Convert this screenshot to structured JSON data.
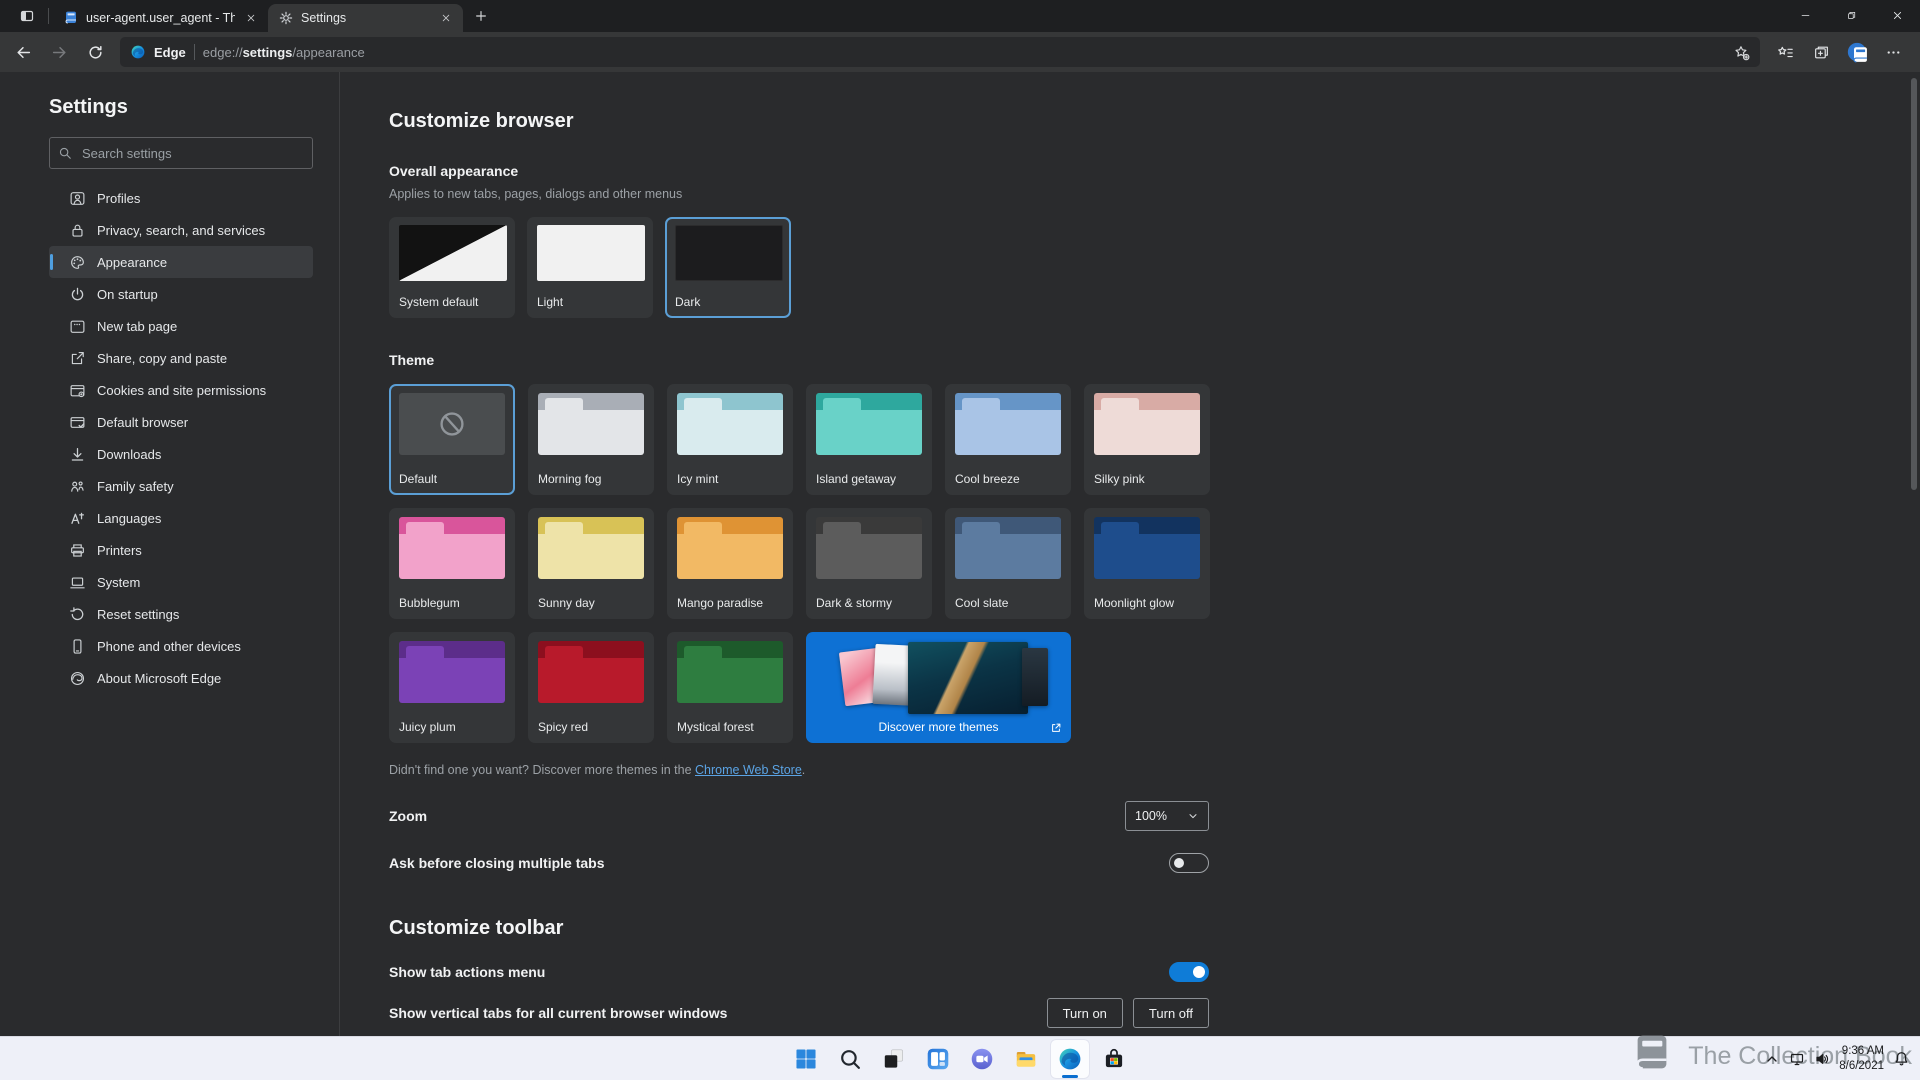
{
  "window": {
    "tabs": [
      {
        "title": "user-agent.user_agent - The Coll",
        "icon": "book-icon",
        "active": false
      },
      {
        "title": "Settings",
        "icon": "gear-icon",
        "active": true
      }
    ]
  },
  "toolbar": {
    "site_label": "Edge",
    "url_scheme": "edge://",
    "url_host": "settings",
    "url_path": "/appearance"
  },
  "sidebar": {
    "title": "Settings",
    "search_placeholder": "Search settings",
    "items": [
      {
        "label": "Profiles",
        "icon": "profiles-icon",
        "selected": false
      },
      {
        "label": "Privacy, search, and services",
        "icon": "privacy-lock-icon",
        "selected": false
      },
      {
        "label": "Appearance",
        "icon": "appearance-palette-icon",
        "selected": true
      },
      {
        "label": "On startup",
        "icon": "power-icon",
        "selected": false
      },
      {
        "label": "New tab page",
        "icon": "new-tab-page-icon",
        "selected": false
      },
      {
        "label": "Share, copy and paste",
        "icon": "share-icon",
        "selected": false
      },
      {
        "label": "Cookies and site permissions",
        "icon": "cookies-icon",
        "selected": false
      },
      {
        "label": "Default browser",
        "icon": "default-browser-icon",
        "selected": false
      },
      {
        "label": "Downloads",
        "icon": "download-icon",
        "selected": false
      },
      {
        "label": "Family safety",
        "icon": "family-icon",
        "selected": false
      },
      {
        "label": "Languages",
        "icon": "languages-icon",
        "selected": false
      },
      {
        "label": "Printers",
        "icon": "printer-icon",
        "selected": false
      },
      {
        "label": "System",
        "icon": "laptop-icon",
        "selected": false
      },
      {
        "label": "Reset settings",
        "icon": "reset-icon",
        "selected": false
      },
      {
        "label": "Phone and other devices",
        "icon": "phone-icon",
        "selected": false
      },
      {
        "label": "About Microsoft Edge",
        "icon": "edge-logo-icon",
        "selected": false
      }
    ]
  },
  "main": {
    "title": "Customize browser",
    "overall": {
      "heading": "Overall appearance",
      "subheading": "Applies to new tabs, pages, dialogs and other menus",
      "options": [
        {
          "label": "System default",
          "thumb": "system",
          "selected": false
        },
        {
          "label": "Light",
          "thumb": "light",
          "selected": false
        },
        {
          "label": "Dark",
          "thumb": "dark",
          "selected": true
        }
      ]
    },
    "theme": {
      "heading": "Theme",
      "items": [
        {
          "label": "Default",
          "empty": true,
          "selected": true
        },
        {
          "label": "Morning fog",
          "body": "#e3e5e8",
          "header": "#a9aeb6"
        },
        {
          "label": "Icy mint",
          "body": "#d9ebee",
          "header": "#8ec5cf"
        },
        {
          "label": "Island getaway",
          "body": "#69d2c8",
          "header": "#2ea89e"
        },
        {
          "label": "Cool breeze",
          "body": "#a9c4e6",
          "header": "#6695c7"
        },
        {
          "label": "Silky pink",
          "body": "#eedbd7",
          "header": "#d8aba5"
        },
        {
          "label": "Bubblegum",
          "body": "#f2a2ca",
          "header": "#d9559b"
        },
        {
          "label": "Sunny day",
          "body": "#eee3a8",
          "header": "#d8c256"
        },
        {
          "label": "Mango paradise",
          "body": "#f2b964",
          "header": "#df9334"
        },
        {
          "label": "Dark & stormy",
          "body": "#5c5c5c",
          "header": "#3a3a3a"
        },
        {
          "label": "Cool slate",
          "body": "#5c7ba0",
          "header": "#3f5878"
        },
        {
          "label": "Moonlight glow",
          "body": "#1e4d8c",
          "header": "#12335f"
        },
        {
          "label": "Juicy plum",
          "body": "#7b42b6",
          "header": "#5c2d8a"
        },
        {
          "label": "Spicy red",
          "body": "#b81a2b",
          "header": "#8c0f1e"
        },
        {
          "label": "Mystical forest",
          "body": "#2e7d40",
          "header": "#1d5a2b"
        },
        {
          "label": "Discover more themes",
          "discover": true,
          "background": "#0e71d4"
        }
      ]
    },
    "store_note": {
      "prefix": "Didn't find one you want? Discover more themes in the ",
      "link": "Chrome Web Store",
      "suffix": "."
    },
    "zoom": {
      "label": "Zoom",
      "value": "100%"
    },
    "ask_close": {
      "label": "Ask before closing multiple tabs",
      "enabled": false
    },
    "toolbar_section": {
      "title": "Customize toolbar",
      "show_tab_actions": {
        "label": "Show tab actions menu",
        "enabled": true
      },
      "vertical_tabs": {
        "label": "Show vertical tabs for all current browser windows",
        "turn_on": "Turn on",
        "turn_off": "Turn off"
      }
    }
  },
  "taskbar": {
    "icons": [
      {
        "name": "start-icon"
      },
      {
        "name": "taskbar-search-icon"
      },
      {
        "name": "task-view-icon"
      },
      {
        "name": "widgets-icon"
      },
      {
        "name": "chat-icon"
      },
      {
        "name": "file-explorer-icon"
      },
      {
        "name": "edge-icon",
        "active": true
      },
      {
        "name": "store-icon"
      }
    ],
    "tray": {
      "time": "9:36 AM",
      "date": "8/6/2021"
    },
    "watermark": "The Collection Book"
  },
  "colors": {
    "accent_selection": "#5b9fd6",
    "toggle_on": "#0f7cd7",
    "link": "#5ba4e5",
    "discover_card": "#0e71d4"
  }
}
